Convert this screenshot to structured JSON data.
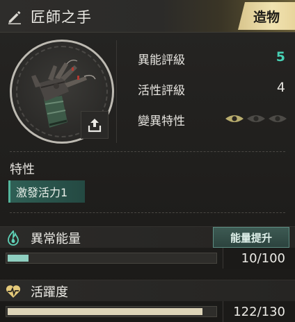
{
  "header": {
    "title": "匠師之手",
    "category_badge": "造物",
    "icons": {
      "edit": "pencil-icon"
    }
  },
  "item": {
    "image": "mechanical-hand-artifact",
    "share_icon": "share-icon"
  },
  "stats": [
    {
      "label": "異能評級",
      "value": "5",
      "accent": "#47d0b4"
    },
    {
      "label": "活性評級",
      "value": "4"
    },
    {
      "label": "變異特性",
      "eyes_active": 1,
      "eyes_total": 3
    }
  ],
  "traits": {
    "title": "特性",
    "items": [
      "激發活力1"
    ]
  },
  "energy": {
    "title": "異常能量",
    "icon": "flame-icon",
    "boost_label": "能量提升",
    "current": 10,
    "max": 100,
    "value_text": "10/100",
    "fill_color": "#8fcfc0"
  },
  "activity": {
    "title": "活躍度",
    "icon": "heart-pulse-icon",
    "current": 122,
    "max": 130,
    "value_text": "122/130",
    "fill_color": "#ddd4b8"
  },
  "colors": {
    "accent_teal": "#47d0b4",
    "badge_gold": "#e8d59c"
  }
}
